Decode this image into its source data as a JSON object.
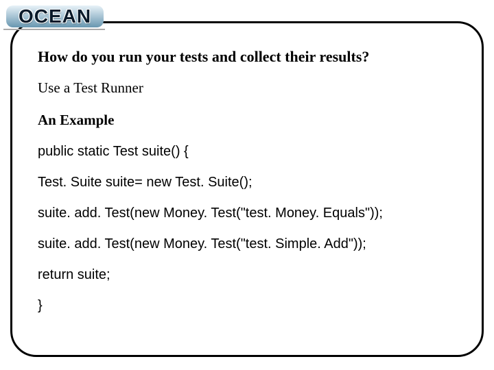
{
  "logo": {
    "text": "OCEAN"
  },
  "slide": {
    "heading": "How do you run your tests and collect their results?",
    "subline": "Use a Test Runner",
    "example_label": "An Example",
    "code": {
      "line1": "public static Test suite() {",
      "line2": "Test. Suite suite= new Test. Suite();",
      "line3": "suite. add. Test(new Money. Test(\"test. Money. Equals\"));",
      "line4": "suite. add. Test(new Money. Test(\"test. Simple. Add\"));",
      "line5": "return suite;",
      "line6": "}"
    }
  }
}
